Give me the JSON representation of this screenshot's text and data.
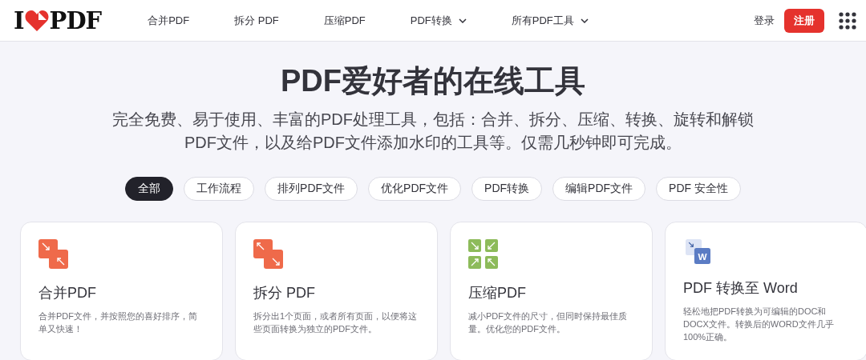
{
  "logo": {
    "left": "I",
    "right": "PDF"
  },
  "nav": [
    {
      "label": "合并PDF",
      "dropdown": false
    },
    {
      "label": "拆分 PDF",
      "dropdown": false
    },
    {
      "label": "压缩PDF",
      "dropdown": false
    },
    {
      "label": "PDF转换",
      "dropdown": true
    },
    {
      "label": "所有PDF工具",
      "dropdown": true
    }
  ],
  "login": "登录",
  "signup": "注册",
  "hero": {
    "title": "PDF爱好者的在线工具",
    "subtitle": "完全免费、易于使用、丰富的PDF处理工具，包括：合并、拆分、压缩、转换、旋转和解锁PDF文件，以及给PDF文件添加水印的工具等。仅需几秒钟即可完成。"
  },
  "filters": [
    {
      "label": "全部",
      "selected": true
    },
    {
      "label": "工作流程",
      "selected": false
    },
    {
      "label": "排列PDF文件",
      "selected": false
    },
    {
      "label": "优化PDF文件",
      "selected": false
    },
    {
      "label": "PDF转换",
      "selected": false
    },
    {
      "label": "编辑PDF文件",
      "selected": false
    },
    {
      "label": "PDF 安全性",
      "selected": false
    }
  ],
  "tools": [
    {
      "kind": "merge",
      "title": "合并PDF",
      "description": "合并PDF文件，并按照您的喜好排序，简单又快速！"
    },
    {
      "kind": "split",
      "title": "拆分 PDF",
      "description": "拆分出1个页面，或者所有页面，以便将这些页面转换为独立的PDF文件。"
    },
    {
      "kind": "compress",
      "title": "压缩PDF",
      "description": "减小PDF文件的尺寸，但同时保持最佳质量。优化您的PDF文件。"
    },
    {
      "kind": "word",
      "title": "PDF 转换至 Word",
      "description": "轻松地把PDF转换为可编辑的DOC和DOCX文件。转换后的WORD文件几乎100%正确。",
      "icon_text": "W"
    }
  ]
}
